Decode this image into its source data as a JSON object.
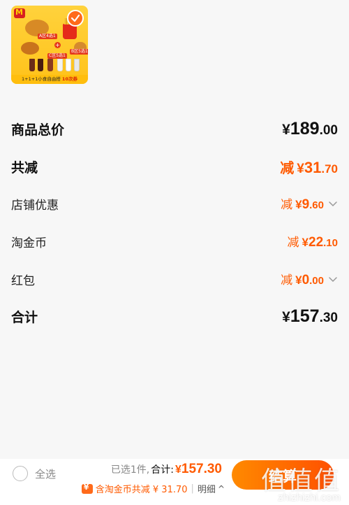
{
  "product": {
    "tag_a": "A区4选1",
    "tag_b": "B区5选1",
    "tag_c": "C区5选1",
    "plus": "+",
    "promo_prefix": "1+1+1小食自由搭",
    "promo_highlight": "10次券"
  },
  "rows": [
    {
      "label": "商品总价",
      "prefix": "¥",
      "int": "189",
      "dec": ".00"
    },
    {
      "label": "共减",
      "reduce": "减",
      "prefix": "¥",
      "int": "31",
      "dec": ".70"
    },
    {
      "label": "店铺优惠",
      "reduce": "减",
      "prefix": "¥",
      "int": "9",
      "dec": ".60"
    },
    {
      "label": "淘金币",
      "reduce": "减",
      "prefix": "¥",
      "int": "22",
      "dec": ".10"
    },
    {
      "label": "红包",
      "reduce": "减",
      "prefix": "¥",
      "int": "0",
      "dec": ".00"
    },
    {
      "label": "合计",
      "prefix": "¥",
      "int": "157",
      "dec": ".30"
    }
  ],
  "bottom": {
    "select_all": "全选",
    "selected": "已选1件,",
    "total_label": "合计:",
    "prefix": "¥",
    "total_value": "157.30",
    "coin_text": "含淘金币共减 ¥ 31.70",
    "separator": "|",
    "detail": "明细",
    "detail_arrow": "^",
    "checkout": "结算"
  },
  "watermark": {
    "big": "值值值",
    "small": "zhizhizhi.com"
  },
  "colors": {
    "accent": "#ff5a00",
    "checkout_start": "#ff8a00",
    "checkout_end": "#ff5000",
    "background": "#f7f7f7"
  }
}
